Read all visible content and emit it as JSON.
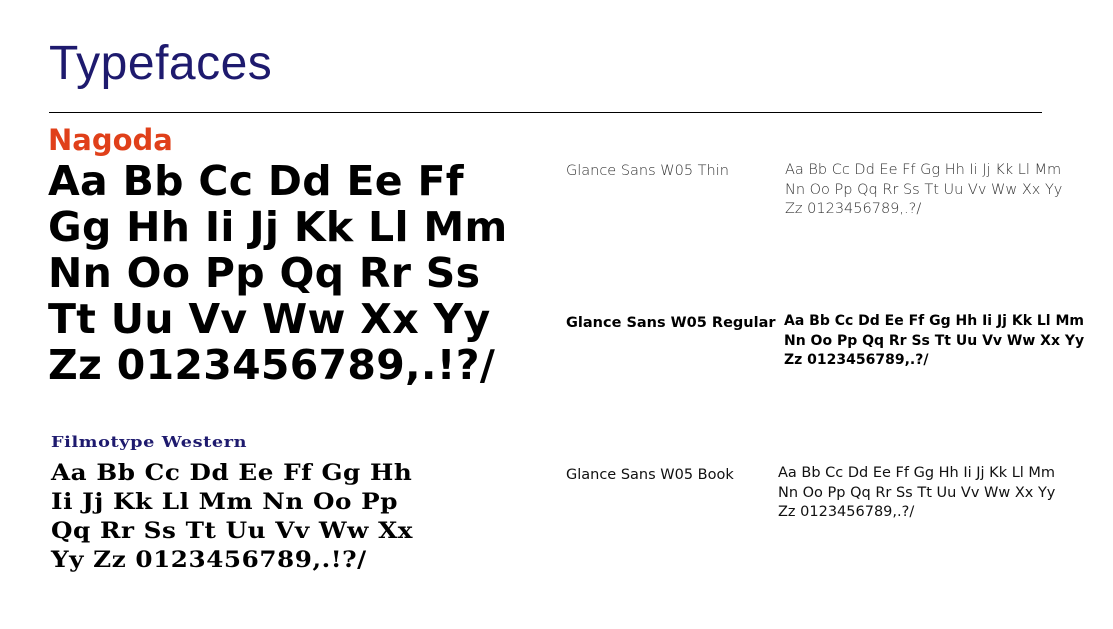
{
  "page": {
    "title": "Typefaces"
  },
  "nagoda": {
    "name": "Nagoda",
    "sample_lines": [
      "Aa Bb Cc Dd Ee Ff",
      "Gg Hh Ii Jj Kk Ll Mm",
      "Nn Oo Pp Qq Rr Ss",
      "Tt Uu Vv Ww Xx Yy",
      "Zz 0123456789,.!?/"
    ],
    "name_color": "#e0401a"
  },
  "filmotype": {
    "name": "Filmotype Western",
    "sample_lines": [
      "Aa Bb Cc Dd Ee Ff Gg Hh",
      "Ii Jj Kk Ll Mm Nn Oo Pp",
      "Qq Rr Ss Tt Uu Vv Ww Xx",
      "Yy Zz  0123456789,.!?/"
    ],
    "name_color": "#1e1a6e"
  },
  "glance": [
    {
      "name": "Glance Sans W05 Thin",
      "sample_lines": [
        "Aa Bb Cc Dd Ee Ff Gg Hh Ii Jj Kk Ll Mm",
        "Nn Oo Pp Qq Rr Ss Tt Uu Vv Ww Xx Yy",
        "Zz 0123456789,.?/"
      ]
    },
    {
      "name": "Glance Sans W05 Regular",
      "sample_lines": [
        "Aa Bb Cc Dd Ee Ff Gg Hh Ii Jj Kk Ll Mm",
        "Nn Oo Pp Qq Rr Ss Tt Uu Vv Ww Xx Yy",
        "Zz 0123456789,.?/"
      ]
    },
    {
      "name": "Glance Sans W05 Book",
      "sample_lines": [
        "Aa Bb Cc Dd Ee Ff Gg Hh Ii Jj Kk Ll Mm",
        "Nn Oo Pp Qq Rr Ss Tt Uu Vv Ww Xx Yy",
        "Zz 0123456789,.?/"
      ]
    }
  ],
  "colors": {
    "title": "#1e1a6e",
    "accent": "#e0401a",
    "text": "#000000"
  }
}
